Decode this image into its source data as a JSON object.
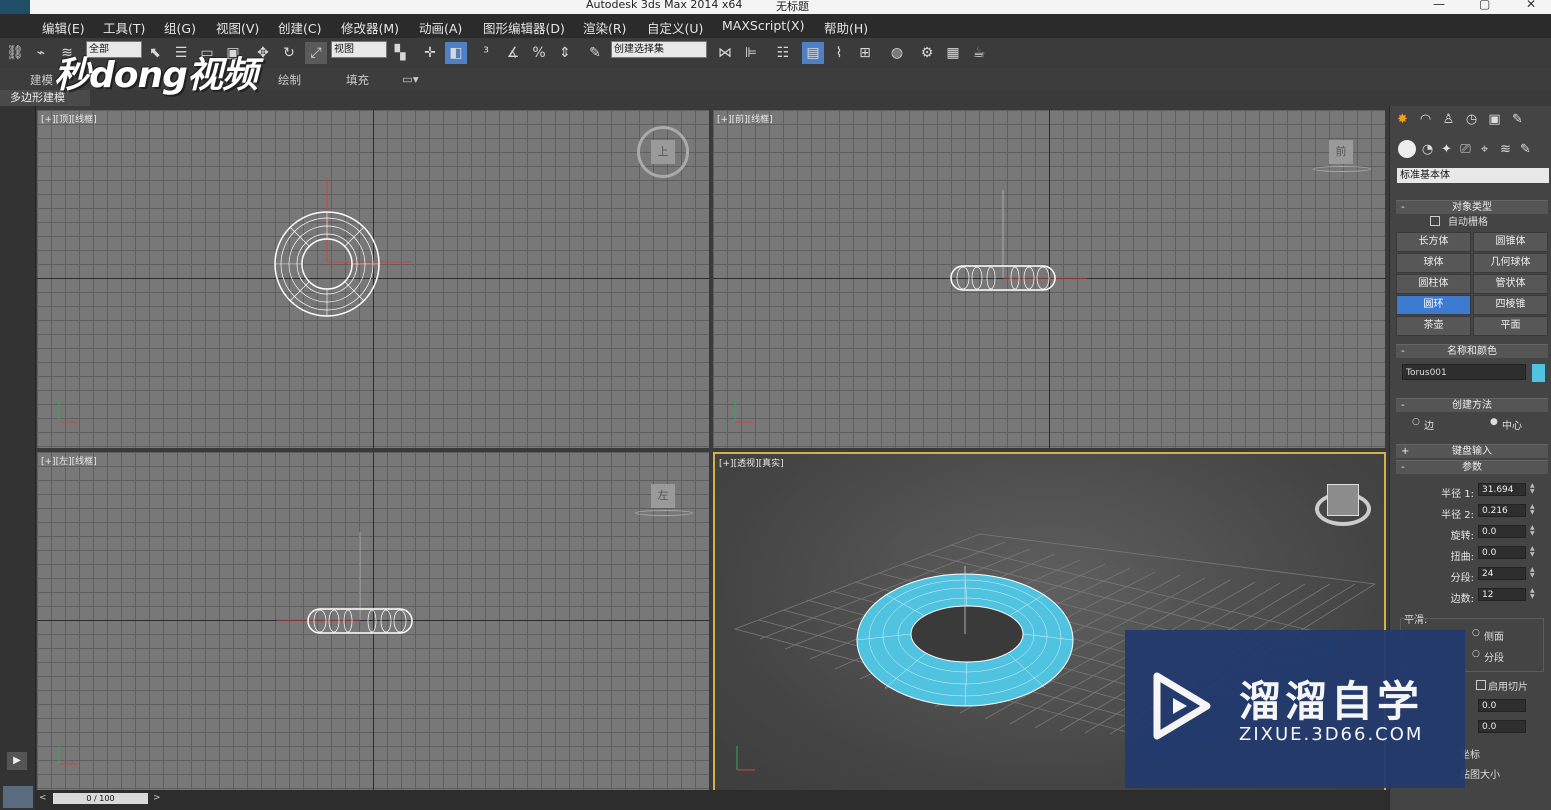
{
  "title_bar": {
    "app_title": "Autodesk 3ds Max  2014 x64",
    "document": "无标题"
  },
  "menu": [
    "编辑(E)",
    "工具(T)",
    "组(G)",
    "视图(V)",
    "创建(C)",
    "修改器(M)",
    "动画(A)",
    "图形编辑器(D)",
    "渲染(R)",
    "自定义(U)",
    "MAXScript(X)",
    "帮助(H)"
  ],
  "toolbar": {
    "selection_filter": "全部",
    "ref_coord": "视图",
    "named_selection": "创建选择集"
  },
  "ribbon": {
    "tabs": [
      "建模",
      "绘制",
      "填充"
    ],
    "subpanel": "多边形建模"
  },
  "watermark_top": "秒dong视频",
  "viewports": {
    "top": {
      "label": "[+][顶][线框]",
      "cube": "上"
    },
    "front": {
      "label": "[+][前][线框]",
      "cube": "前"
    },
    "left": {
      "label": "[+][左][线框]",
      "cube": "左"
    },
    "persp": {
      "label": "[+][透视][真实]"
    }
  },
  "timeline": {
    "frame": "0 / 100"
  },
  "command_panel": {
    "category": "标准基本体",
    "object_type": {
      "title": "对象类型",
      "autogrid": "自动栅格",
      "buttons": [
        "长方体",
        "圆锥体",
        "球体",
        "几何球体",
        "圆柱体",
        "管状体",
        "圆环",
        "四棱锥",
        "茶壶",
        "平面"
      ],
      "active": "圆环"
    },
    "name_color": {
      "title": "名称和颜色",
      "name": "Torus001",
      "swatch": "#4fc3e0"
    },
    "creation": {
      "title": "创建方法",
      "options": [
        "边",
        "中心"
      ],
      "selected": "中心"
    },
    "keyboard": "键盘输入",
    "params": {
      "title": "参数",
      "fields": [
        {
          "label": "半径 1:",
          "value": "31.694"
        },
        {
          "label": "半径 2:",
          "value": "0.216"
        },
        {
          "label": "旋转:",
          "value": "0.0"
        },
        {
          "label": "扭曲:",
          "value": "0.0"
        },
        {
          "label": "分段:",
          "value": "24"
        },
        {
          "label": "边数:",
          "value": "12"
        }
      ],
      "smooth": "平滑:",
      "smooth_options": [
        "侧面",
        "分段"
      ],
      "slice": "启用切片",
      "slice_from": "0.0",
      "slice_to": "0.0",
      "tail1": "坐标",
      "tail2": "贴图大小"
    }
  },
  "zixue": {
    "brand": "溜溜自学",
    "url": "ZIXUE.3D66.COM"
  },
  "colors": {
    "accent_active": "#3d7bd0",
    "torus": "#4fc3e0",
    "viewport_border": "#d4b24a"
  }
}
